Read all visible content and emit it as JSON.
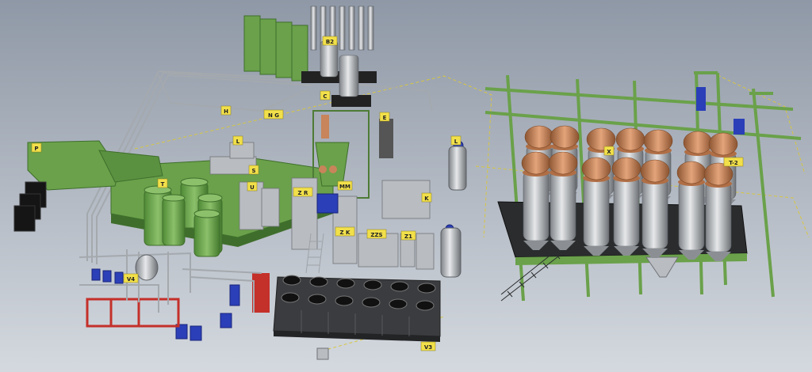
{
  "colors": {
    "background_top": "#8f98a6",
    "background_bottom": "#d4d9df",
    "equipment_green": "#6aa14a",
    "equipment_green_dark": "#3f6e2c",
    "steel_grey": "#b9bcc0",
    "steel_dark": "#707377",
    "pipe_grey": "#9ea3a8",
    "tag_yellow": "#f2e04a",
    "motor_blue": "#2b3fb8",
    "copper": "#c8845a",
    "frame_red": "#c4302a",
    "black_unit": "#151515"
  },
  "tags": [
    {
      "id": "tag-p",
      "text": "P"
    },
    {
      "id": "tag-b2",
      "text": "B2"
    },
    {
      "id": "tag-c",
      "text": "C"
    },
    {
      "id": "tag-e",
      "text": "E"
    },
    {
      "id": "tag-h",
      "text": "H"
    },
    {
      "id": "tag-ng",
      "text": "N G"
    },
    {
      "id": "tag-ls",
      "text": "L"
    },
    {
      "id": "tag-mm",
      "text": "MM"
    },
    {
      "id": "tag-u",
      "text": "U"
    },
    {
      "id": "tag-t",
      "text": "T"
    },
    {
      "id": "tag-k",
      "text": "K"
    },
    {
      "id": "tag-zk",
      "text": "Z K"
    },
    {
      "id": "tag-zzs",
      "text": "ZZS"
    },
    {
      "id": "tag-zl",
      "text": "Z1"
    },
    {
      "id": "tag-zr",
      "text": "Z R"
    },
    {
      "id": "tag-v3",
      "text": "V3"
    },
    {
      "id": "tag-v4",
      "text": "V4"
    },
    {
      "id": "tag-s",
      "text": "S"
    },
    {
      "id": "tag-ls2",
      "text": "L"
    },
    {
      "id": "tag-t2",
      "text": "T-2"
    },
    {
      "id": "tag-ax",
      "text": "X"
    }
  ]
}
